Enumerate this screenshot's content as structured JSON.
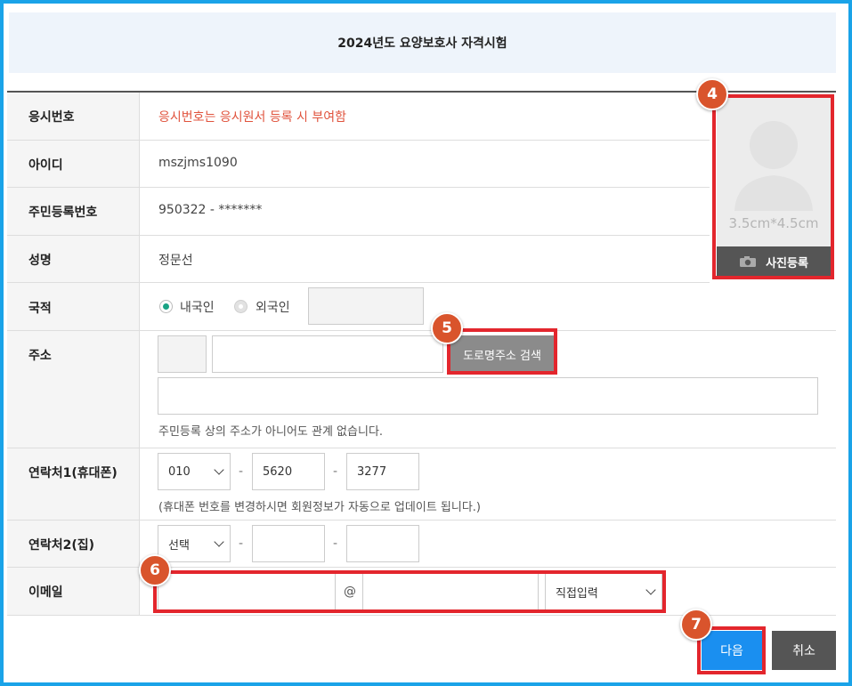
{
  "header": {
    "title": "2024년도 요양보호사 자격시험"
  },
  "fields": {
    "exam_number": {
      "label": "응시번호",
      "value": "응시번호는 응시원서 등록 시 부여함"
    },
    "user_id": {
      "label": "아이디",
      "value": "mszjms1090"
    },
    "resident_number": {
      "label": "주민등록번호",
      "value": "950322 - *******"
    },
    "name": {
      "label": "성명",
      "value": "정문선"
    },
    "nationality": {
      "label": "국적",
      "option_domestic": "내국인",
      "option_foreign": "외국인",
      "selected": "내국인"
    },
    "address": {
      "label": "주소",
      "search_button": "도로명주소 검색",
      "note": "주민등록 상의 주소가 아니어도 관계 없습니다."
    },
    "phone1": {
      "label": "연락처1(휴대폰)",
      "prefix": "010",
      "middle": "5620",
      "last": "3277",
      "separator": "-",
      "note": "(휴대폰 번호를 변경하시면 회원정보가 자동으로 업데이트 됩니다.)"
    },
    "phone2": {
      "label": "연락처2(집)",
      "prefix": "선택",
      "separator": "-"
    },
    "email": {
      "label": "이메일",
      "at": "@",
      "domain_select": "직접입력"
    }
  },
  "photo": {
    "size_text": "3.5cm*4.5cm",
    "register_button": "사진등록",
    "icon": "camera-icon"
  },
  "buttons": {
    "next": "다음",
    "cancel": "취소"
  },
  "annotations": {
    "photo": "4",
    "road_search": "5",
    "email": "6",
    "next": "7"
  },
  "colors": {
    "frame_border": "#1aa3e8",
    "highlight": "#e3262d",
    "badge": "#d9542c",
    "next_button": "#1a8ff0",
    "exam_number_text": "#e0533d",
    "radio_selected": "#19a384"
  }
}
